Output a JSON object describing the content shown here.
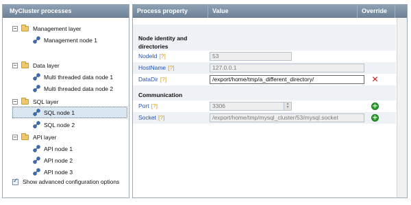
{
  "left": {
    "title": "MyCluster processes",
    "tree": [
      {
        "type": "layer",
        "label": "Management layer",
        "toggle": "−"
      },
      {
        "type": "node",
        "label": "Management node 1"
      },
      {
        "type": "layer",
        "label": "Data layer",
        "toggle": "−"
      },
      {
        "type": "node",
        "label": "Multi threaded data node 1"
      },
      {
        "type": "node",
        "label": "Multi threaded data node 2"
      },
      {
        "type": "layer",
        "label": "SQL layer",
        "toggle": "−"
      },
      {
        "type": "node",
        "label": "SQL node 1",
        "selected": true
      },
      {
        "type": "node",
        "label": "SQL node 2"
      },
      {
        "type": "layer",
        "label": "API layer",
        "toggle": "−"
      },
      {
        "type": "node",
        "label": "API node 1"
      },
      {
        "type": "node",
        "label": "API node 2"
      },
      {
        "type": "node",
        "label": "API node 3"
      }
    ],
    "advanced_label": "Show advanced configuration options",
    "advanced_checked": true
  },
  "right": {
    "headers": {
      "property": "Process property",
      "value": "Value",
      "override": "Override"
    },
    "sections": {
      "identity": "Node identity and directories",
      "communication": "Communication"
    },
    "help_marker": "[?]",
    "rows": {
      "nodeid": {
        "label": "NodeId",
        "value": "53"
      },
      "hostname": {
        "label": "HostName",
        "value": "127.0.0.1"
      },
      "datadir": {
        "label": "DataDir",
        "value": "/export/home/tmp/a_different_directory/"
      },
      "port": {
        "label": "Port",
        "value": "3306"
      },
      "socket": {
        "label": "Socket",
        "value": "/export/home/tmp/mysql_cluster/53/mysql.socket"
      }
    }
  },
  "colors": {
    "header": "#7f93a8",
    "link": "#1f52b3",
    "help": "#d29a1f",
    "delete": "#c61e1e",
    "add": "#2d9a2d"
  }
}
